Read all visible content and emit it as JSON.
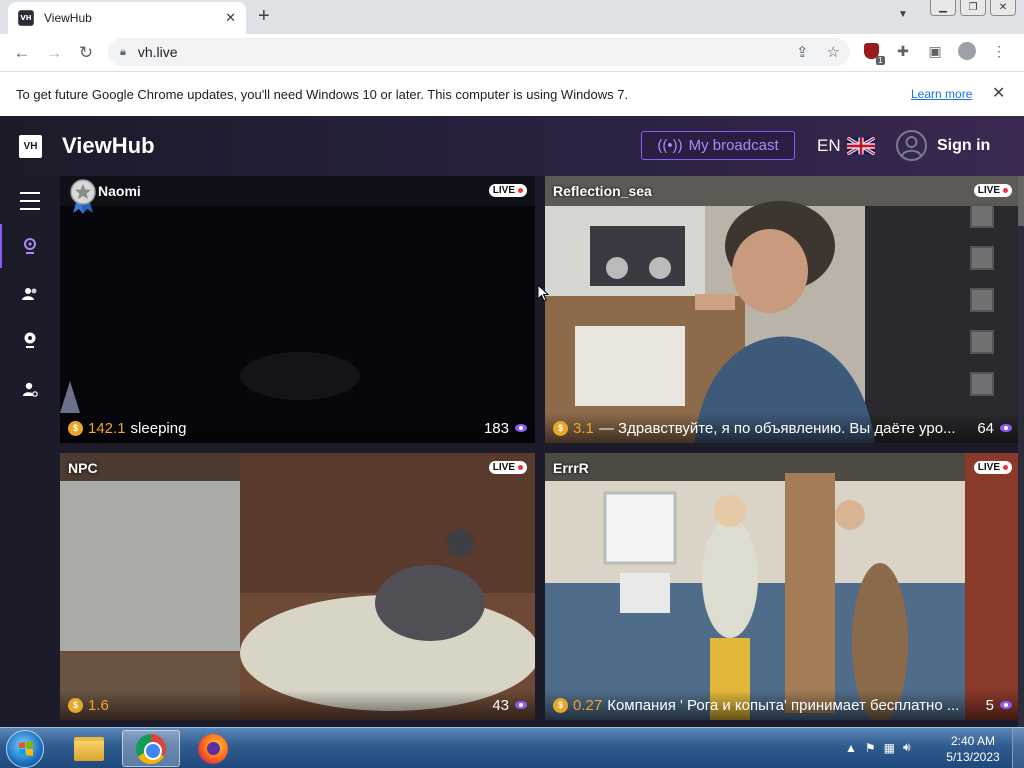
{
  "browser": {
    "tab_title": "ViewHub",
    "favicon_text": "VH",
    "url": "vh.live",
    "new_tab_symbol": "+",
    "close_symbol": "✕"
  },
  "infobar": {
    "message": "To get future Google Chrome updates, you'll need Windows 10 or later. This computer is using Windows 7.",
    "link": "Learn more"
  },
  "extension": {
    "badge": "1"
  },
  "site": {
    "logo": "VH",
    "brand": "ViewHub",
    "broadcast_label": "My broadcast",
    "language": "EN",
    "signin_label": "Sign in",
    "accent_color": "#8b5cf6",
    "coin_color": "#e9a72a"
  },
  "sidebar": {
    "items": [
      {
        "icon": "webcam-icon"
      },
      {
        "icon": "users-icon"
      },
      {
        "icon": "broadcast-eye-icon"
      },
      {
        "icon": "user-settings-icon"
      }
    ]
  },
  "streams": [
    {
      "name": "Naomi",
      "live": "LIVE",
      "coins": "142.1",
      "status": "sleeping",
      "viewers": "183"
    },
    {
      "name": "Reflection_sea",
      "live": "LIVE",
      "coins": "3.1",
      "status": "— Здравствуйте, я по объявлению. Вы даёте уро...",
      "viewers": "64"
    },
    {
      "name": "NPC",
      "live": "LIVE",
      "coins": "1.6",
      "status": "",
      "viewers": "43"
    },
    {
      "name": "ErrrR",
      "live": "LIVE",
      "coins": "0.27",
      "status": "Компания ' Рога и копыта' принимает бесплатно ...",
      "viewers": "5"
    }
  ],
  "taskbar": {
    "time": "2:40 AM",
    "date": "5/13/2023",
    "apps": [
      "explorer-icon",
      "chrome-icon",
      "firefox-icon"
    ]
  }
}
